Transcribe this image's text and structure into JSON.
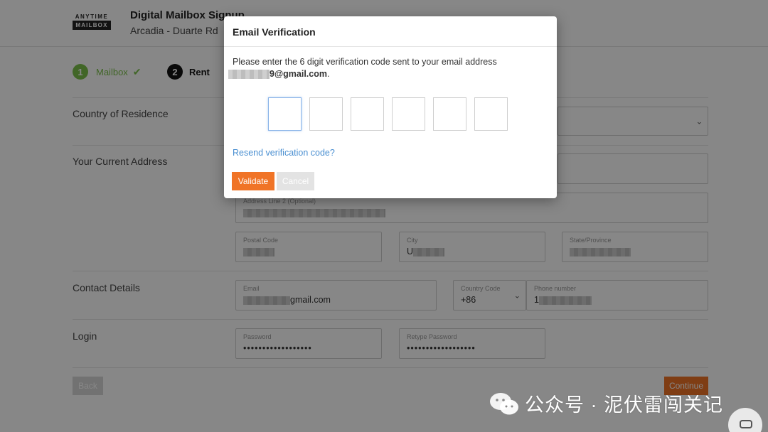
{
  "header": {
    "logo_top": "ANYTIME",
    "logo_bottom": "MAILBOX",
    "title": "Digital Mailbox Signup",
    "subtitle": "Arcadia - Duarte Rd"
  },
  "steps": [
    {
      "number": "1",
      "label": "Mailbox",
      "status": "done"
    },
    {
      "number": "2",
      "label": "Rent",
      "status": "active"
    }
  ],
  "form": {
    "country_label": "Country of Residence",
    "address_label": "Your Current Address",
    "address_line2_label": "Address Line 2 (Optional)",
    "postal_code_label": "Postal Code",
    "city_label": "City",
    "city_value_prefix": "U",
    "state_label": "State/Province",
    "contact_label": "Contact Details",
    "email_label": "Email",
    "email_value_suffix": "gmail.com",
    "country_code_label": "Country Code",
    "country_code_value": "+86",
    "phone_label": "Phone number",
    "phone_value_prefix": "1",
    "login_label": "Login",
    "password_label": "Password",
    "password_value": "••••••••••••••••••",
    "retype_password_label": "Retype Password",
    "retype_password_value": "••••••••••••••••••"
  },
  "buttons": {
    "back": "Back",
    "continue": "Continue"
  },
  "modal": {
    "title": "Email Verification",
    "message": "Please enter the 6 digit verification code sent to your email address",
    "email_suffix": "9@gmail.com",
    "email_end": ".",
    "resend": "Resend verification code?",
    "validate": "Validate",
    "cancel": "Cancel",
    "code_digits": [
      "",
      "",
      "",
      "",
      "",
      ""
    ]
  },
  "watermark": {
    "text": "公众号 · 泥伏雷闯关记"
  },
  "colors": {
    "accent": "#f07427",
    "step_done": "#7cc04b",
    "link": "#4a8fd1"
  }
}
